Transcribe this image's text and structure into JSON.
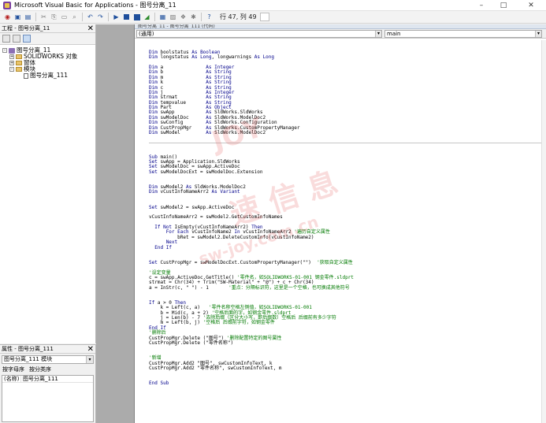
{
  "window": {
    "title": "Microsoft Visual Basic for Applications - 图号分离_11",
    "controls": {
      "minimize": "–",
      "maximize": "□",
      "close": "✕"
    }
  },
  "toolbar": {
    "position_label": "行 47, 列 49"
  },
  "project_pane": {
    "title": "工程 - 图号分离_11",
    "tree": [
      {
        "label": "图号分离_11",
        "level": 0,
        "kind": "vba",
        "expander": "–"
      },
      {
        "label": "SOLIDWORKS 对象",
        "level": 1,
        "kind": "folder",
        "expander": "+"
      },
      {
        "label": "窗体",
        "level": 1,
        "kind": "folder",
        "expander": "+"
      },
      {
        "label": "模块",
        "level": 1,
        "kind": "folder",
        "expander": "–"
      },
      {
        "label": "图号分离_111",
        "level": 2,
        "kind": "module",
        "expander": ""
      }
    ]
  },
  "properties_pane": {
    "title": "属性 - 图号分离_111",
    "object_combo": "图号分离_111 模块",
    "tabs": [
      "按字母序",
      "按分类序"
    ],
    "rows": [
      {
        "key": "(名称)",
        "value": "图号分离_111"
      }
    ]
  },
  "code_window": {
    "title": "图号分离_11 - 图号分离_111 (代码)",
    "object_combo": "(通用)",
    "proc_combo": "main",
    "declarations": [
      "Dim boolstatus As Boolean",
      "Dim longstatus As Long, longwarnings As Long",
      "",
      "Dim a               As Integer",
      "Dim b               As String",
      "Dim m               As String",
      "Dim k               As String",
      "Dim c               As String",
      "Dim j               As Integer",
      "Dim strmat          As String",
      "Dim tempvalue       As String",
      "Dim Part            As Object",
      "Dim swApp           As SldWorks.SldWorks",
      "Dim swModelDoc      As SldWorks.ModelDoc2",
      "Dim swConfig        As SldWorks.Configuration",
      "Dim CustPropMgr     As SldWorks.CustomPropertyManager",
      "Dim swModel         As SldWorks.ModelDoc2"
    ],
    "main_code": [
      {
        "t": "Sub main()",
        "c": ""
      },
      {
        "t": "Set swApp = Application.SldWorks",
        "c": ""
      },
      {
        "t": "Set swModelDoc = swApp.ActiveDoc",
        "c": ""
      },
      {
        "t": "Set swModelDocExt = swModelDoc.Extension",
        "c": ""
      },
      {
        "t": "",
        "c": ""
      },
      {
        "t": "",
        "c": ""
      },
      {
        "t": "Dim swModel2 As SldWorks.ModelDoc2",
        "c": ""
      },
      {
        "t": "Dim vCustInfoNameArr2 As Variant",
        "c": ""
      },
      {
        "t": "",
        "c": ""
      },
      {
        "t": "",
        "c": ""
      },
      {
        "t": "Set swModel2 = swApp.ActiveDoc",
        "c": ""
      },
      {
        "t": "",
        "c": ""
      },
      {
        "t": "vCustInfoNameArr2 = swModel2.GetCustomInfoNames",
        "c": ""
      },
      {
        "t": "",
        "c": ""
      },
      {
        "t": "  If Not IsEmpty(vCustInfoNameArr2) Then",
        "c": ""
      },
      {
        "t": "      For Each vCustInfoName2 In vCustInfoNameArr2 ",
        "c": "'遍历自定义属性"
      },
      {
        "t": "          bRet = swModel2.DeleteCustomInfo(vCustInfoName2)",
        "c": ""
      },
      {
        "t": "      Next",
        "c": ""
      },
      {
        "t": "  End If",
        "c": ""
      },
      {
        "t": "",
        "c": ""
      },
      {
        "t": "",
        "c": ""
      },
      {
        "t": "Set CustPropMgr = swModelDocExt.CustomPropertyManager(\"\")  ",
        "c": "'获取自定义属性"
      },
      {
        "t": "",
        "c": ""
      },
      {
        "t": "",
        "c": "'设定变量"
      },
      {
        "t": "c = swApp.ActiveDoc.GetTitle() ",
        "c": "'零件名，如SOLIDWORKS-01-001 钢金零件.sldprt"
      },
      {
        "t": "strmat = Chr(34) + Trim(\"SW-Material\" + \"@\") + c + Chr(34)",
        "c": ""
      },
      {
        "t": "a = InStr(c, \" \") - 1       ",
        "c": "'重点：分隔标识符，这里是一个空格，也可换成其他符号"
      },
      {
        "t": "",
        "c": ""
      },
      {
        "t": "",
        "c": ""
      },
      {
        "t": "If a > 0 Then",
        "c": ""
      },
      {
        "t": "    k = Left(c, a)   ",
        "c": "'零件名称空格左侧值，如SOLIDWORKS-01-001"
      },
      {
        "t": "    b = Mid(c, a + 2) ",
        "c": "'空格后面的字，如钢金零件.sldprt"
      },
      {
        "t": "    j = Len(b) - 7 ",
        "c": "'去除后缀（区分大小写，即后缀数）空格后 后缀前有多少字符"
      },
      {
        "t": "    m = Left(b, j) ",
        "c": "'空格后 后缀前字符，如钢金零件"
      },
      {
        "t": "End If",
        "c": ""
      },
      {
        "t": "",
        "c": "'删除后"
      },
      {
        "t": "CustPropMgr.Delete (\"图号\") ",
        "c": "'删除配置特定的图号属性"
      },
      {
        "t": "CustPropMgr.Delete (\"零件名称\")",
        "c": ""
      },
      {
        "t": "",
        "c": ""
      },
      {
        "t": "",
        "c": ""
      },
      {
        "t": "",
        "c": "'新增"
      },
      {
        "t": "CustPropMgr.Add2 \"图号\", swCustomInfoText, k",
        "c": ""
      },
      {
        "t": "CustPropMgr.Add2 \"零件名称\", swCustomInfoText, m",
        "c": ""
      },
      {
        "t": "",
        "c": ""
      },
      {
        "t": "",
        "c": ""
      },
      {
        "t": "End Sub",
        "c": ""
      }
    ]
  },
  "watermark": {
    "lines": [
      "JOY",
      "速 信 息",
      "sw-joy.com.cn"
    ]
  }
}
